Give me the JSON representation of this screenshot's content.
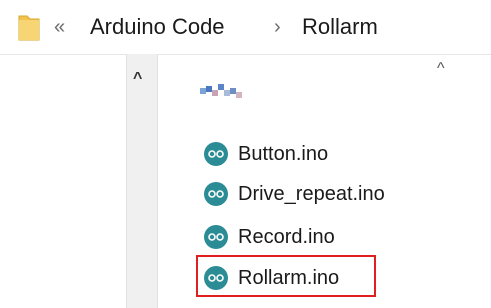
{
  "breadcrumb": {
    "overflow_glyph": "«",
    "parent": "Arduino Code",
    "separator_glyph": "›",
    "current": "Rollarm"
  },
  "nav": {
    "scroll_up_glyph": "^"
  },
  "content": {
    "scroll_up_glyph": "^",
    "files": [
      {
        "name": "Button.ino",
        "icon": "arduino-file-icon"
      },
      {
        "name": "Drive_repeat.ino",
        "icon": "arduino-file-icon"
      },
      {
        "name": "Record.ino",
        "icon": "arduino-file-icon"
      },
      {
        "name": "Rollarm.ino",
        "icon": "arduino-file-icon",
        "highlighted": true
      }
    ]
  },
  "colors": {
    "folder": "#f3c24a",
    "arduino_icon": "#2b8c96",
    "highlight": "#e02020"
  }
}
